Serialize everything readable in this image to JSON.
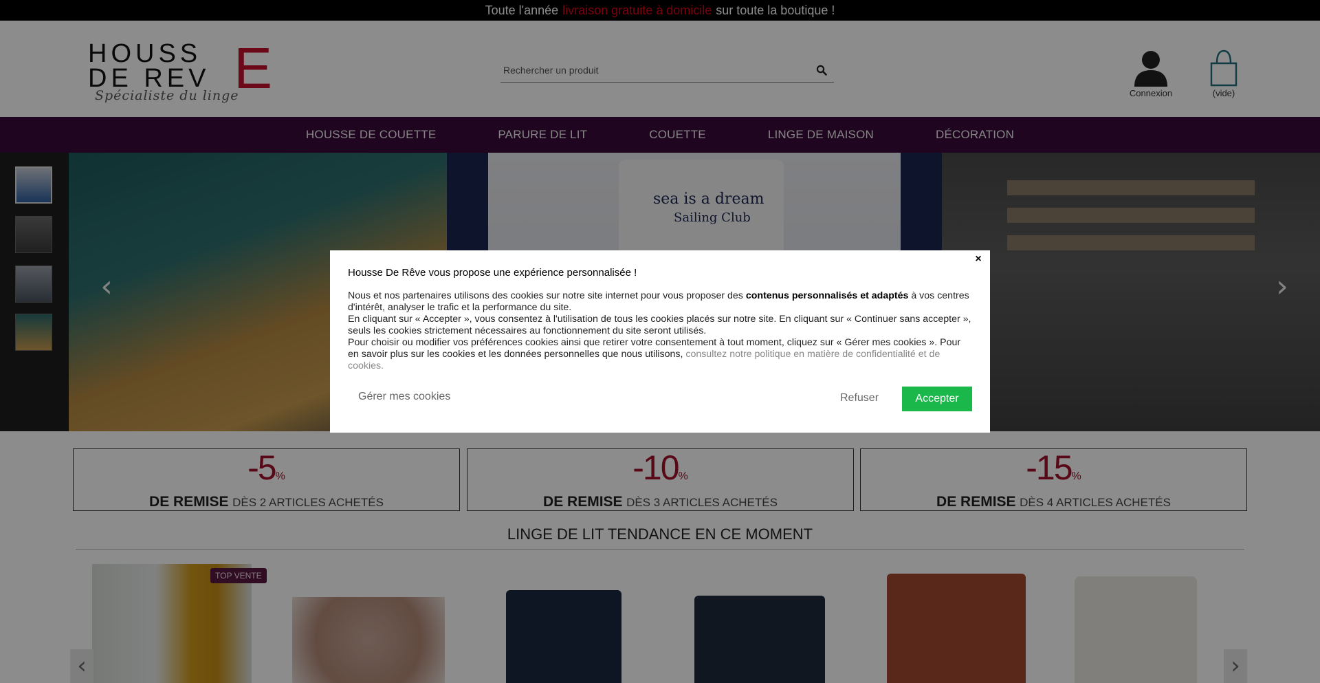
{
  "topbar": {
    "part1": "Toute l'année",
    "highlight": "livraison gratuite à domicile",
    "part2": "sur toute la boutique !"
  },
  "logo": {
    "line1": "HOUSS",
    "line2": "DE REV",
    "big_letter": "E",
    "tagline": "Spécialiste du linge"
  },
  "search": {
    "placeholder": "Rechercher un produit"
  },
  "account": {
    "label": "Connexion"
  },
  "cart": {
    "label": "(vide)"
  },
  "nav": {
    "items": [
      "HOUSSE DE COUETTE",
      "PARURE DE LIT",
      "COUETTE",
      "LINGE DE MAISON",
      "DÉCORATION"
    ]
  },
  "slider": {
    "pillow_text1": "sea is a dream",
    "pillow_text2": "Sailing Club",
    "prev_arrow": "‹",
    "next_arrow": "›"
  },
  "promos": [
    {
      "pct": "-5",
      "unit": "%",
      "bold": "DE REMISE",
      "rest": "DÈS 2 ARTICLES ACHETÉS"
    },
    {
      "pct": "-10",
      "unit": "%",
      "bold": "DE REMISE",
      "rest": "DÈS 3 ARTICLES ACHETÉS"
    },
    {
      "pct": "-15",
      "unit": "%",
      "bold": "DE REMISE",
      "rest": "DÈS 4 ARTICLES ACHETÉS"
    }
  ],
  "section": {
    "title": "LINGE DE LIT TENDANCE EN CE MOMENT"
  },
  "products": {
    "badge": "TOP VENTE"
  },
  "modal": {
    "title": "Housse De Rêve vous propose une expérience personnalisée !",
    "p1_a": "Nous et nos partenaires utilisons des cookies sur notre site internet pour vous proposer des ",
    "p1_b": "contenus personnalisés et adaptés",
    "p1_c": " à vos centres d'intérêt, analyser le trafic et la performance du site.",
    "p2": "En cliquant sur « Accepter », vous consentez à l'utilisation de tous les cookies placés sur notre site. En cliquant sur « Continuer sans accepter », seuls les cookies strictement nécessaires au fonctionnement du site seront utilisés.",
    "p3_a": "Pour choisir ou modifier vos préférences cookies ainsi que retirer votre consentement à tout moment, cliquez sur « Gérer mes cookies ». Pour en savoir plus sur les cookies et les données personnelles que nous utilisons, ",
    "p3_link": "consultez notre politique en matière de confidentialité et de cookies.",
    "manage_label": "Gérer mes cookies",
    "refuse_label": "Refuser",
    "accept_label": "Accepter",
    "close_label": "×"
  },
  "colors": {
    "topbar_highlight": "#e0001b",
    "nav_bg": "#3a0a3a",
    "promo_accent": "#a0102a",
    "accept_button": "#1ab84a"
  }
}
